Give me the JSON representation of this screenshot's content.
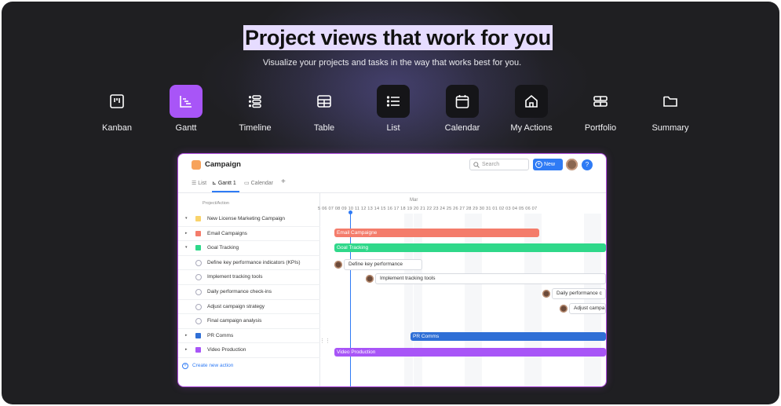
{
  "hero": {
    "title": "Project views that work for you",
    "subtitle": "Visualize your projects and tasks in the way that works best for you."
  },
  "views": [
    {
      "label": "Kanban",
      "icon": "kanban-icon",
      "active": false
    },
    {
      "label": "Gantt",
      "icon": "gantt-icon",
      "active": true
    },
    {
      "label": "Timeline",
      "icon": "timeline-icon",
      "active": false
    },
    {
      "label": "Table",
      "icon": "table-icon",
      "active": false
    },
    {
      "label": "List",
      "icon": "list-icon",
      "active": false
    },
    {
      "label": "Calendar",
      "icon": "calendar-icon",
      "active": false
    },
    {
      "label": "My Actions",
      "icon": "home-icon",
      "active": false
    },
    {
      "label": "Portfolio",
      "icon": "portfolio-icon",
      "active": false
    },
    {
      "label": "Summary",
      "icon": "folder-icon",
      "active": false
    }
  ],
  "app": {
    "project_title": "Campaign",
    "search_placeholder": "Search",
    "new_label": "New",
    "help_label": "?",
    "tabs": [
      "List",
      "Gantt",
      "Calendar"
    ],
    "tab_badge": "1",
    "add_tab": "+",
    "column_header": "Project/Action",
    "month": "Mar",
    "days": "5 06 07 08 09 10 11 12 13 14 15 16 17 18 19 20 21 22 23 24 25 26 27 28 29 30 31 01 02 03 04 05 06 07",
    "rows": [
      {
        "caret": "▾",
        "kind": "square",
        "color": "#f9d36b",
        "text": "New License Marketing Campaign"
      },
      {
        "caret": "▸",
        "kind": "square",
        "color": "#f47c6b",
        "text": "Email Campaigns"
      },
      {
        "caret": "▾",
        "kind": "square",
        "color": "#2fd88a",
        "text": "Goal Tracking"
      },
      {
        "caret": "",
        "kind": "check",
        "color": "",
        "text": "Define key performance indicators (KPIs)"
      },
      {
        "caret": "",
        "kind": "check",
        "color": "",
        "text": "Implement tracking tools"
      },
      {
        "caret": "",
        "kind": "check",
        "color": "",
        "text": "Daily performance check-ins"
      },
      {
        "caret": "",
        "kind": "check",
        "color": "",
        "text": "Adjust campaign strategy"
      },
      {
        "caret": "",
        "kind": "check",
        "color": "",
        "text": "Final campaign analysis"
      },
      {
        "caret": "▸",
        "kind": "square",
        "color": "#2f6fd6",
        "text": "PR Comms"
      },
      {
        "caret": "▸",
        "kind": "square",
        "color": "#a855f7",
        "text": "Video Production"
      }
    ],
    "create_label": "Create new action",
    "bars": {
      "email": "Email Campaigne",
      "goal": "Goal Tracking",
      "kpi": "Define key performance",
      "tools": "Implement tracking tools",
      "daily": "Daily performance c",
      "adjust": "Adjust campa",
      "pr": "PR Comms",
      "video": "Video Production"
    }
  },
  "colors": {
    "accent": "#a855f7",
    "highlight": "#e6dcff",
    "blue": "#2f7bf5",
    "email_bar": "#f47c6b",
    "goal_bar": "#2fd88a",
    "pr_bar": "#2f6fd6",
    "video_bar": "#a855f7"
  }
}
